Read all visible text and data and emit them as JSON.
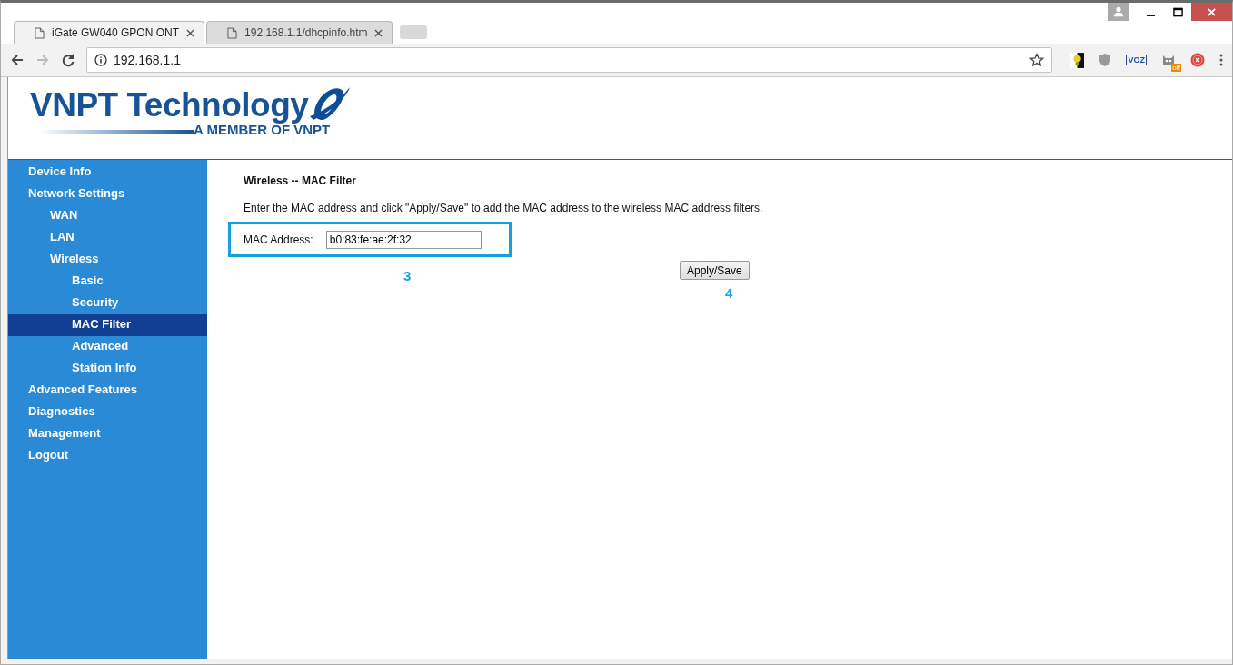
{
  "browser": {
    "tabs": [
      {
        "title": "iGate GW040 GPON ONT",
        "selected": true
      },
      {
        "title": "192.168.1.1/dhcpinfo.htm",
        "selected": false
      }
    ],
    "address": "192.168.1.1",
    "extensions": {
      "voz_label": "VOZ",
      "badge": "off"
    }
  },
  "header": {
    "brand": "VNPT Technology",
    "tagline": "A MEMBER OF VNPT"
  },
  "sidebar": {
    "items": [
      {
        "label": "Device Info",
        "selected": false
      },
      {
        "label": "Network Settings",
        "selected": false,
        "children": [
          {
            "label": "WAN",
            "selected": false
          },
          {
            "label": "LAN",
            "selected": false
          },
          {
            "label": "Wireless",
            "selected": false,
            "children": [
              {
                "label": "Basic",
                "selected": false
              },
              {
                "label": "Security",
                "selected": false
              },
              {
                "label": "MAC Filter",
                "selected": true
              },
              {
                "label": "Advanced",
                "selected": false
              },
              {
                "label": "Station Info",
                "selected": false
              }
            ]
          }
        ]
      },
      {
        "label": "Advanced Features",
        "selected": false
      },
      {
        "label": "Diagnostics",
        "selected": false
      },
      {
        "label": "Management",
        "selected": false
      },
      {
        "label": "Logout",
        "selected": false
      }
    ]
  },
  "content": {
    "title": "Wireless -- MAC Filter",
    "description": "Enter the MAC address and click \"Apply/Save\" to add the MAC address to the wireless MAC address filters.",
    "mac_label": "MAC Address:",
    "mac_value": "b0:83:fe:ae:2f:32",
    "button": "Apply/Save",
    "annotations": [
      {
        "label": "3"
      },
      {
        "label": "4"
      }
    ]
  }
}
